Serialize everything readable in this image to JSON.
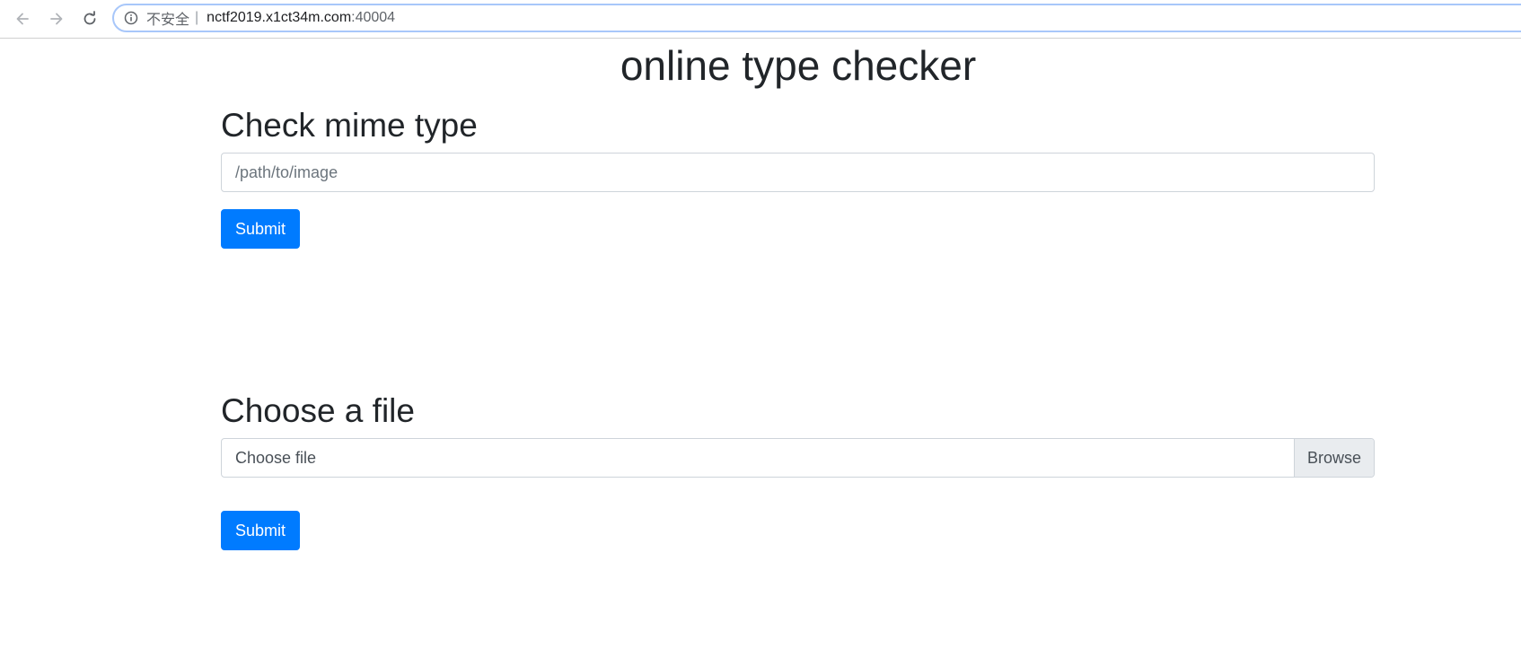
{
  "browser": {
    "security_label": "不安全",
    "separator": "|",
    "url_host": "nctf2019.x1ct34m.com",
    "url_port": ":40004"
  },
  "page": {
    "title": "online type checker"
  },
  "mime_section": {
    "heading": "Check mime type",
    "input_placeholder": "/path/to/image",
    "submit_label": "Submit"
  },
  "file_section": {
    "heading": "Choose a file",
    "file_label": "Choose file",
    "browse_label": "Browse",
    "submit_label": "Submit"
  },
  "colors": {
    "primary": "#007bff",
    "text": "#212529",
    "input_border": "#ced4da"
  }
}
